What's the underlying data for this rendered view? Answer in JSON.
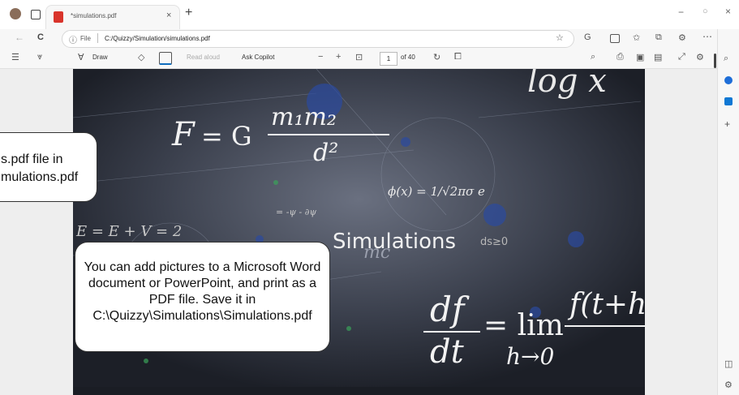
{
  "tab": {
    "title": "*simulations.pdf",
    "close": "×",
    "new_tab": "+"
  },
  "window_controls": {
    "minimize": "−",
    "maximize": "○",
    "close": "×"
  },
  "address": {
    "back": "←",
    "reload": "C",
    "info": "ⓘ",
    "file_label": "File",
    "url": "C:/Quizzy/Simulation/simulations.pdf"
  },
  "pdf_toolbar": {
    "draw_label": "Draw",
    "read_aloud_label": "Read aloud",
    "ask_copilot_label": "Ask Copilot",
    "zoom_out": "−",
    "zoom_in": "+",
    "current_page": "1",
    "total_pages": "of 40"
  },
  "page": {
    "title": "Simulations",
    "equations": {
      "gravity_f": "F",
      "gravity_eq": "= G",
      "gravity_num": "m₁m₂",
      "gravity_den": "d²",
      "diff_num": "df",
      "diff_den": "dt",
      "diff_lim": "= lim",
      "diff_lim_sub": "h→0",
      "diff_rhs": "f(t+h",
      "log_text": "log x",
      "phi_text": "ϕ(x) = 1/√2πσ e",
      "schrod_text": "= -ψ - ∂ψ",
      "energy_text": "E = E + V = 2",
      "ds_text": "ds≥0",
      "me_text": "mc"
    }
  },
  "callouts": {
    "left_partial": "s.pdf file in\nmulations.pdf",
    "main": "You can add pictures to a Microsoft Word document or PowerPoint, and print as a PDF file. Save it in C:\\Quizzy\\Simulations\\Simulations.pdf"
  },
  "colors": {
    "accent": "#0f6cbd",
    "pdf_red": "#d9342b",
    "chalkboard": "#2a2e38"
  }
}
